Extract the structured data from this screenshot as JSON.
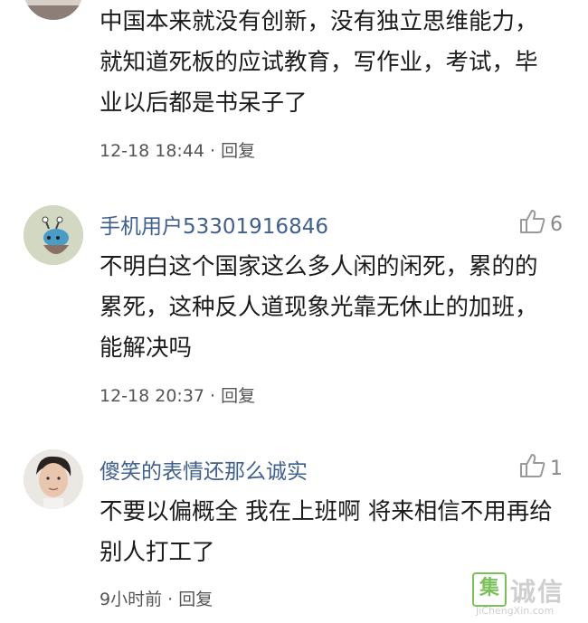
{
  "comments": [
    {
      "username": "",
      "likes": "",
      "text": "中国本来就没有创新，没有独立思维能力，就知道死板的应试教育，写作业，考试，毕业以后都是书呆子了",
      "time": "12-18 18:44",
      "separator": " · ",
      "reply_label": "回复"
    },
    {
      "username": "手机用户53301916846",
      "likes": "6",
      "text": "不明白这个国家这么多人闲的闲死，累的的累死，这种反人道现象光靠无休止的加班，能解决吗",
      "time": "12-18 20:37",
      "separator": " · ",
      "reply_label": "回复"
    },
    {
      "username": "傻笑的表情还那么诚实",
      "likes": "1",
      "text": "不要以偏概全 我在上班啊 将来相信不用再给别人打工了",
      "time": "9小时前",
      "separator": " · ",
      "reply_label": "回复"
    }
  ],
  "watermark": {
    "box_char": "集",
    "chars": "诚信",
    "url": "JiChengXin.com"
  },
  "colors": {
    "username": "#40608d",
    "text": "#1b1b1b",
    "meta": "#555555",
    "like": "#8a8a8a",
    "watermark": "#7cc05a"
  },
  "icons": {
    "like": "thumbs-up-icon"
  }
}
